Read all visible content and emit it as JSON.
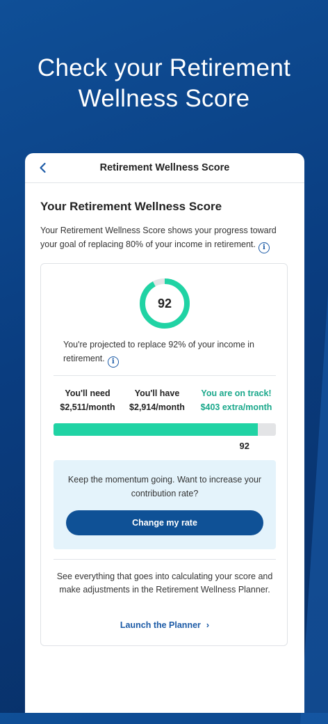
{
  "hero": {
    "headline_line1": "Check your Retirement",
    "headline_line2": "Wellness Score"
  },
  "navbar": {
    "title": "Retirement Wellness Score",
    "back_icon": "chevron-left-icon"
  },
  "section": {
    "title": "Your Retirement Wellness Score",
    "description": "Your Retirement Wellness Score shows your progress toward your goal of replacing 80% of your income in retirement."
  },
  "score": {
    "value": "92",
    "fraction": 0.92,
    "ring_color": "#20d3a4",
    "track_color": "#e3e4e6"
  },
  "projection": {
    "text": "You're projected to replace 92% of your income in retirement."
  },
  "stats": {
    "need_label": "You'll need",
    "need_value": "$2,511/month",
    "have_label": "You'll have",
    "have_value": "$2,914/month",
    "track_label": "You are on track!",
    "track_value": "$403 extra/month"
  },
  "progress": {
    "label": "92",
    "fraction": 0.92
  },
  "momentum": {
    "text": "Keep the momentum going. Want to increase your contribution rate?",
    "button_label": "Change my rate"
  },
  "planner": {
    "text": "See everything that goes into calculating your score and make adjustments in the Retirement Wellness Planner.",
    "link_label": "Launch the Planner"
  },
  "colors": {
    "brand_blue": "#0f5196",
    "success_green": "#1aa88b"
  }
}
